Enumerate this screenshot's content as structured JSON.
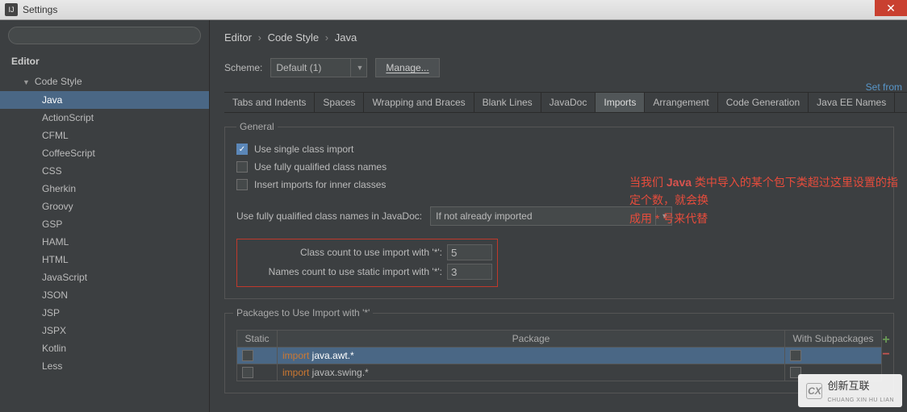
{
  "window": {
    "title": "Settings"
  },
  "search": {
    "placeholder": ""
  },
  "tree": {
    "root": "Editor",
    "group": "Code Style",
    "items": [
      "Java",
      "ActionScript",
      "CFML",
      "CoffeeScript",
      "CSS",
      "Gherkin",
      "Groovy",
      "GSP",
      "HAML",
      "HTML",
      "JavaScript",
      "JSON",
      "JSP",
      "JSPX",
      "Kotlin",
      "Less"
    ],
    "selected": "Java"
  },
  "breadcrumb": [
    "Editor",
    "Code Style",
    "Java"
  ],
  "scheme": {
    "label": "Scheme:",
    "value": "Default (1)",
    "manage": "Manage..."
  },
  "setfrom": "Set from",
  "tabs": [
    "Tabs and Indents",
    "Spaces",
    "Wrapping and Braces",
    "Blank Lines",
    "JavaDoc",
    "Imports",
    "Arrangement",
    "Code Generation",
    "Java EE Names"
  ],
  "active_tab": "Imports",
  "general": {
    "legend": "General",
    "use_single": "Use single class import",
    "use_fq": "Use fully qualified class names",
    "insert_inner": "Insert imports for inner classes",
    "fq_javadoc_label": "Use fully qualified class names in JavaDoc:",
    "fq_javadoc_value": "If not already imported",
    "class_count_label": "Class count to use import with '*':",
    "class_count_value": "5",
    "names_count_label": "Names count to use static import with '*':",
    "names_count_value": "3"
  },
  "annotation": {
    "line1_a": "当我们 ",
    "line1_b": "Java",
    "line1_c": " 类中导入的某个包下类超过这里设置的指定个数，就会换",
    "line2": "成用 * 号来代替"
  },
  "packages": {
    "legend": "Packages to Use Import with '*'",
    "cols": [
      "Static",
      "Package",
      "With Subpackages"
    ],
    "rows": [
      {
        "static": false,
        "kw": "import",
        "text": " java.awt.*",
        "sub": false,
        "sel": true
      },
      {
        "static": false,
        "kw": "import",
        "text": " javax.swing.*",
        "sub": false,
        "sel": false
      }
    ]
  },
  "watermark": {
    "brand": "创新互联",
    "sub": "CHUANG XIN HU LIAN"
  }
}
